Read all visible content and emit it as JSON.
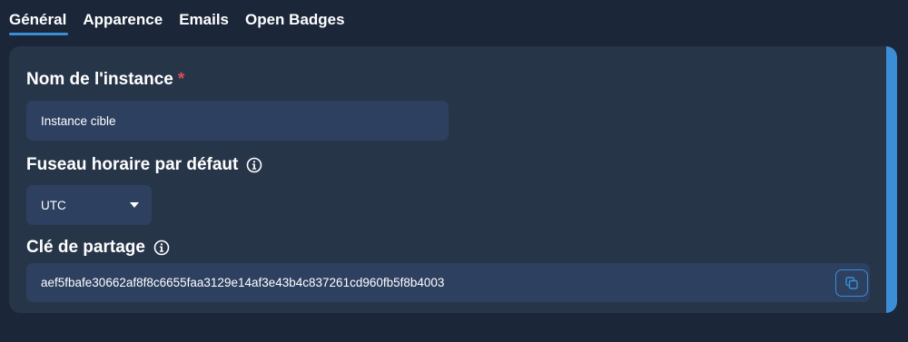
{
  "tabs": [
    {
      "label": "Général",
      "active": true
    },
    {
      "label": "Apparence",
      "active": false
    },
    {
      "label": "Emails",
      "active": false
    },
    {
      "label": "Open Badges",
      "active": false
    }
  ],
  "form": {
    "instance_name": {
      "label": "Nom de l'instance",
      "required_mark": "*",
      "value": "Instance cible"
    },
    "timezone": {
      "label": "Fuseau horaire par défaut",
      "info_icon": "info-icon",
      "value": "UTC"
    },
    "share_key": {
      "label": "Clé de partage",
      "info_icon": "info-icon",
      "value": "aef5fbafe30662af8f8c6655faa3129e14af3e43b4c837261cd960fb5f8b4003",
      "copy_icon": "copy-icon"
    }
  },
  "colors": {
    "background": "#1b2639",
    "panel": "#273549",
    "field": "#2d4060",
    "accent": "#3b8ed6",
    "required": "#e04a55"
  }
}
